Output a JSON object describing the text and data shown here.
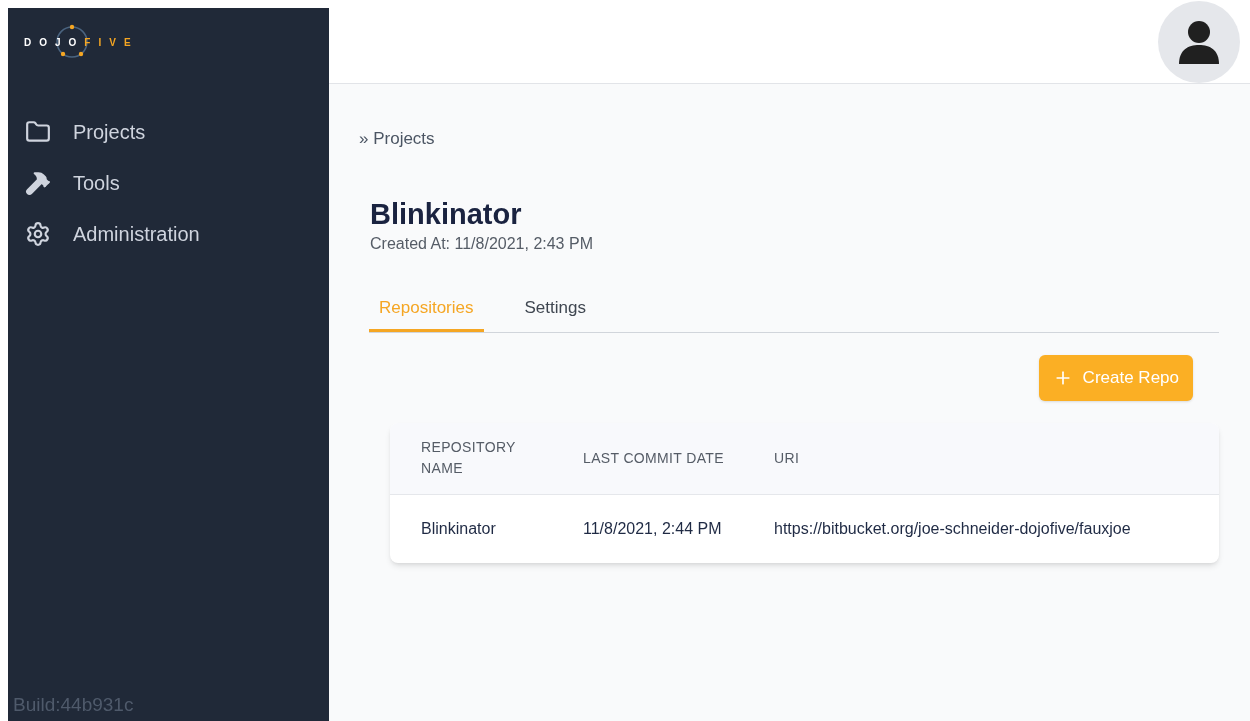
{
  "sidebar": {
    "logo": {
      "left": "DOJO",
      "right": "FIVE"
    },
    "items": [
      {
        "label": "Projects"
      },
      {
        "label": "Tools"
      },
      {
        "label": "Administration"
      }
    ],
    "build": "Build:44b931c"
  },
  "breadcrumb": "» Projects",
  "project": {
    "title": "Blinkinator",
    "created": "Created At: 11/8/2021, 2:43 PM"
  },
  "tabs": [
    {
      "label": "Repositories",
      "selected": true
    },
    {
      "label": "Settings",
      "selected": false
    }
  ],
  "create_button": "Create Repo",
  "table": {
    "columns": [
      "REPOSITORY NAME",
      "LAST COMMIT DATE",
      "URI"
    ],
    "rows": [
      [
        "Blinkinator",
        "11/8/2021, 2:44 PM",
        "https://bitbucket.org/joe-schneider-dojofive/fauxjoe"
      ]
    ]
  }
}
